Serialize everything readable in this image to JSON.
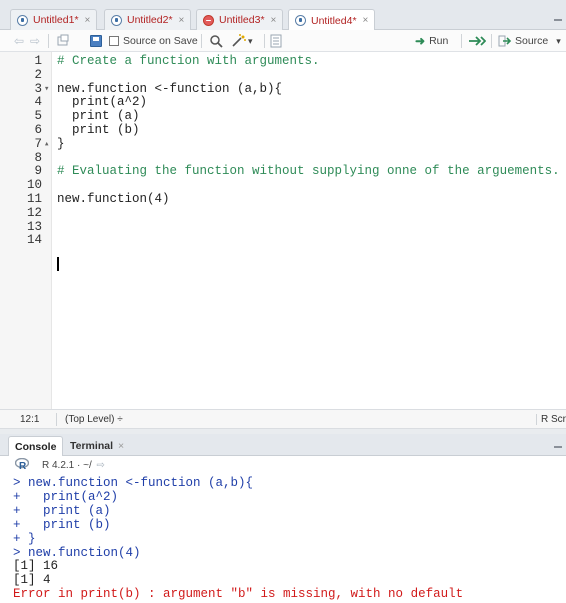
{
  "tabs": [
    {
      "label": "Untitled1*",
      "close": "×",
      "icon": "r-file-icon"
    },
    {
      "label": "Untitled2*",
      "close": "×",
      "icon": "r-file-icon"
    },
    {
      "label": "Untitled3*",
      "close": "×",
      "icon": "r-error-file-icon"
    },
    {
      "label": "Untitled4*",
      "close": "×",
      "icon": "r-file-icon"
    }
  ],
  "toolbar": {
    "source_on_save": "Source on Save",
    "run": "Run",
    "source": "Source",
    "source_dropdown": "▾",
    "wand_dropdown": "▾"
  },
  "editor": {
    "lines": [
      {
        "n": "1",
        "text": "# Create a function with arguments.",
        "type": "comment",
        "fold": ""
      },
      {
        "n": "2",
        "text": "",
        "type": "code",
        "fold": ""
      },
      {
        "n": "3",
        "text": "new.function <-function (a,b){",
        "type": "code",
        "fold": "▾"
      },
      {
        "n": "4",
        "text": "  print(a^2)",
        "type": "code",
        "fold": ""
      },
      {
        "n": "5",
        "text": "  print (a)",
        "type": "code",
        "fold": ""
      },
      {
        "n": "6",
        "text": "  print (b)",
        "type": "code",
        "fold": ""
      },
      {
        "n": "7",
        "text": "}",
        "type": "code",
        "fold": "▴"
      },
      {
        "n": "8",
        "text": "",
        "type": "code",
        "fold": ""
      },
      {
        "n": "9",
        "text": "# Evaluating the function without supplying onne of the arguements.",
        "type": "comment",
        "fold": ""
      },
      {
        "n": "10",
        "text": "",
        "type": "code",
        "fold": ""
      },
      {
        "n": "11",
        "text": "new.function(4)",
        "type": "code",
        "fold": ""
      },
      {
        "n": "12",
        "text": "",
        "type": "code",
        "fold": ""
      },
      {
        "n": "13",
        "text": "",
        "type": "code",
        "fold": ""
      },
      {
        "n": "14",
        "text": "",
        "type": "code",
        "fold": ""
      }
    ]
  },
  "status": {
    "position": "12:1",
    "scope": "(Top Level) ÷",
    "filetype": "R Scr"
  },
  "console_tabs": [
    {
      "label": "Console"
    },
    {
      "label": "Terminal",
      "close": "×"
    }
  ],
  "console_info": {
    "version": "R 4.2.1 · ~/"
  },
  "console": {
    "lines": [
      {
        "text": "> new.function <-function (a,b){",
        "type": "input"
      },
      {
        "text": "+   print(a^2)",
        "type": "input"
      },
      {
        "text": "+   print (a)",
        "type": "input"
      },
      {
        "text": "+   print (b)",
        "type": "input"
      },
      {
        "text": "+ }",
        "type": "input"
      },
      {
        "text": "> new.function(4)",
        "type": "input"
      },
      {
        "text": "[1] 16",
        "type": "out"
      },
      {
        "text": "[1] 4",
        "type": "out"
      },
      {
        "text": "Error in print(b) : argument \"b\" is missing, with no default",
        "type": "err"
      }
    ]
  },
  "colors": {
    "comment": "#2e8b57",
    "console_input": "#1f3ea8",
    "console_error": "#d11a1a",
    "tab_label": "#b22222"
  }
}
